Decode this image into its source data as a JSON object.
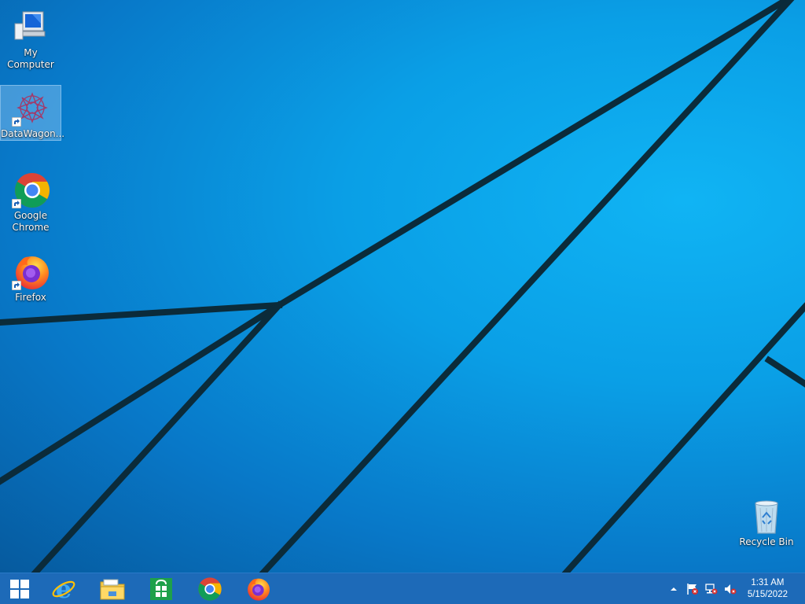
{
  "desktop": {
    "icons": [
      {
        "label": "My Computer",
        "icon": "computer-icon"
      },
      {
        "label": "DataWagon...",
        "icon": "datawagon-icon"
      },
      {
        "label": "Google\nChrome",
        "icon": "chrome-icon"
      },
      {
        "label": "Firefox",
        "icon": "firefox-icon"
      },
      {
        "label": "Recycle Bin",
        "icon": "recycle-bin-icon"
      }
    ]
  },
  "taskbar": {
    "pinned": [
      "start-icon",
      "internet-explorer-icon",
      "file-explorer-icon",
      "store-icon",
      "chrome-icon",
      "firefox-icon"
    ],
    "tray": [
      "show-hidden-icons-chevron",
      "action-center-flag-icon",
      "network-icon",
      "volume-muted-icon"
    ],
    "clock": {
      "time": "1:31 AM",
      "date": "5/15/2022"
    }
  },
  "colors": {
    "taskbar": "#1d6ab8",
    "wallpaper": "#0a9fe6",
    "selection": "#b4dcff"
  }
}
